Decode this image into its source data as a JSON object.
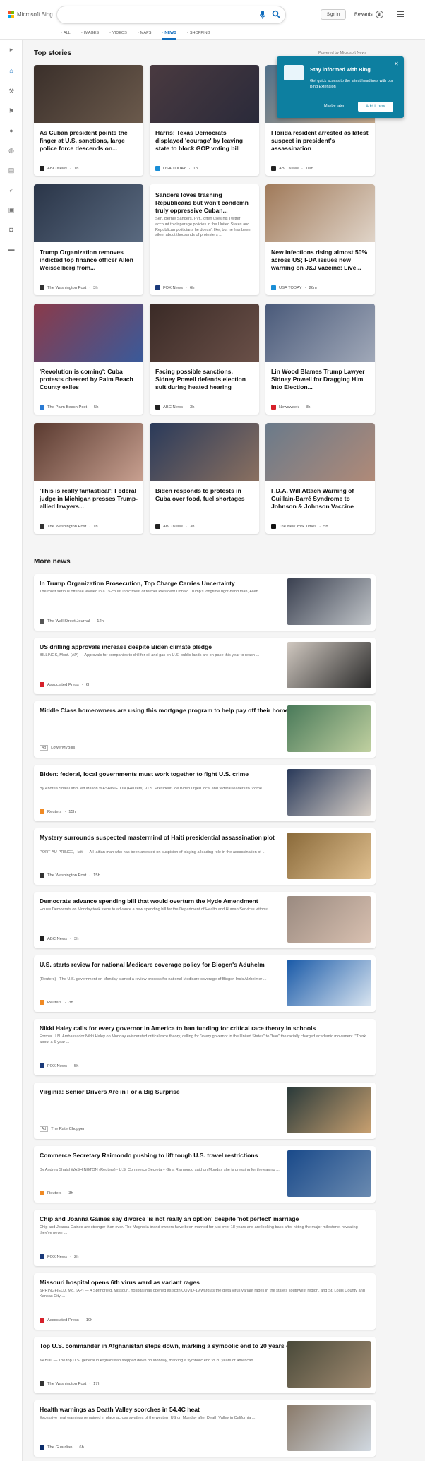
{
  "header": {
    "brand": "Microsoft Bing",
    "signin": "Sign in",
    "rewards": "Rewards"
  },
  "nav": [
    {
      "label": "ALL",
      "icon": "search-icon"
    },
    {
      "label": "IMAGES",
      "icon": "image-icon"
    },
    {
      "label": "VIDEOS",
      "icon": "video-icon"
    },
    {
      "label": "MAPS",
      "icon": "map-pin-icon"
    },
    {
      "label": "NEWS",
      "icon": "news-icon",
      "active": true
    },
    {
      "label": "SHOPPING",
      "icon": "tag-icon"
    }
  ],
  "top": {
    "title": "Top stories",
    "powered": "Powered by Microsoft News"
  },
  "popup": {
    "title": "Stay informed with Bing",
    "body": "Get quick access to the latest headlines with our Bing Extension",
    "later": "Maybe later",
    "add": "Add it now"
  },
  "cards": [
    {
      "title": "As Cuban president points the finger at U.S. sanctions, large police force descends on...",
      "snippet": "",
      "source": "ABC News",
      "time": "1h",
      "logo": "#222"
    },
    {
      "title": "Harris: Texas Democrats displayed 'courage' by leaving state to block GOP voting bill",
      "snippet": "",
      "source": "USA TODAY",
      "time": "1h",
      "logo": "#1a8ed6"
    },
    {
      "title": "Florida resident arrested as latest suspect in president's assassination",
      "snippet": "",
      "source": "ABC News",
      "time": "10m",
      "logo": "#222"
    },
    {
      "title": "Trump Organization removes indicted top finance officer Allen Weisselberg from...",
      "snippet": "",
      "source": "The Washington Post",
      "time": "3h",
      "logo": "#333"
    },
    {
      "title": "Sanders loves trashing Republicans but won't condemn truly oppressive Cuban...",
      "snippet": "Sen. Bernie Sanders, I-Vt., often uses his Twitter account to disparage policies in the United States and Republican politicians he doesn't like, but he has been silent about thousands of protesters ...",
      "source": "FOX News",
      "time": "6h",
      "logo": "#1b3a7a"
    },
    {
      "title": "New infections rising almost 50% across US; FDA issues new warning on J&J vaccine: Live...",
      "snippet": "",
      "source": "USA TODAY",
      "time": "26m",
      "logo": "#1a8ed6"
    },
    {
      "title": "'Revolution is coming': Cuba protests cheered by Palm Beach County exiles",
      "snippet": "",
      "source": "The Palm Beach Post",
      "time": "5h",
      "logo": "#2a7bd4"
    },
    {
      "title": "Facing possible sanctions, Sidney Powell defends election suit during heated hearing",
      "snippet": "",
      "source": "ABC News",
      "time": "3h",
      "logo": "#222"
    },
    {
      "title": "Lin Wood Blames Trump Lawyer Sidney Powell for Dragging Him Into Election...",
      "snippet": "",
      "source": "Newsweek",
      "time": "8h",
      "logo": "#d6202a"
    },
    {
      "title": "'This is really fantastical': Federal judge in Michigan presses Trump-allied lawyers...",
      "snippet": "",
      "source": "The Washington Post",
      "time": "1h",
      "logo": "#333"
    },
    {
      "title": "Biden responds to protests in Cuba over food, fuel shortages",
      "snippet": "",
      "source": "ABC News",
      "time": "3h",
      "logo": "#222"
    },
    {
      "title": "F.D.A. Will Attach Warning of Guillain-Barré Syndrome to Johnson & Johnson Vaccine",
      "snippet": "",
      "source": "The New York Times",
      "time": "5h",
      "logo": "#111"
    }
  ],
  "more": {
    "title": "More news"
  },
  "rows": [
    {
      "title": "In Trump Organization Prosecution, Top Charge Carries Uncertainty",
      "snippet": "The most serious offense leveled in a 15-count indictment of former President Donald Trump's longtime right-hand man, Allen ...",
      "source": "The Wall Street Journal",
      "time": "12h",
      "logo": "#555",
      "ad": false
    },
    {
      "title": "US drilling approvals increase despite Biden climate pledge",
      "snippet": "BILLINGS, Mont. (AP) — Approvals for companies to drill for oil and gas on U.S. public lands are on pace this year to reach ...",
      "source": "Associated Press",
      "time": "6h",
      "logo": "#d6202a",
      "ad": false
    },
    {
      "title": "Middle Class homeowners are using this mortgage program to help pay off their homes.",
      "snippet": "",
      "source": "LowerMyBills",
      "time": "",
      "logo": "#fff",
      "ad": true
    },
    {
      "title": "Biden: federal, local governments must work together to fight U.S. crime",
      "snippet": "By Andrea Shalal and Jeff Mason WASHINGTON (Reuters) -U.S. President Joe Biden urged local and federal leaders to \"come ...",
      "source": "Reuters",
      "time": "15h",
      "logo": "#f08a24",
      "ad": false
    },
    {
      "title": "Mystery surrounds suspected mastermind of Haiti presidential assassination plot",
      "snippet": "PORT-AU-PRINCE, Haiti — A Haitian man who has been arrested on suspicion of playing a leading role in the assassination of ...",
      "source": "The Washington Post",
      "time": "15h",
      "logo": "#333",
      "ad": false
    },
    {
      "title": "Democrats advance spending bill that would overturn the Hyde Amendment",
      "snippet": "House Democrats on Monday took steps to advance a new spending bill for the Department of Health and Human Services without ...",
      "source": "ABC News",
      "time": "3h",
      "logo": "#222",
      "ad": false
    },
    {
      "title": "U.S. starts review for national Medicare coverage policy for Biogen's Aduhelm",
      "snippet": "(Reuters) - The U.S. government on Monday started a review process for national Medicare coverage of Biogen Inc's Alzheimer ...",
      "source": "Reuters",
      "time": "3h",
      "logo": "#f08a24",
      "ad": false
    },
    {
      "title": "Nikki Haley calls for every governor in America to ban funding for critical race theory in schools",
      "snippet": "Former U.N. Ambassador Nikki Haley on Monday eviscerated critical race theory, calling for \"every governor in the United States\" to \"ban\" the racially charged academic movement. \"Think about a 5-year ...",
      "source": "FOX News",
      "time": "5h",
      "logo": "#1b3a7a",
      "ad": false
    },
    {
      "title": "Virginia: Senior Drivers Are in For a Big Surprise",
      "snippet": "",
      "source": "The Rate Chopper",
      "time": "",
      "logo": "#fff",
      "ad": true
    },
    {
      "title": "Commerce Secretary Raimondo pushing to lift tough U.S. travel restrictions",
      "snippet": "By Andrea Shalal WASHINGTON (Reuters) - U.S. Commerce Secretary Gina Raimondo said on Monday she is pressing for the easing ...",
      "source": "Reuters",
      "time": "3h",
      "logo": "#f08a24",
      "ad": false
    },
    {
      "title": "Chip and Joanna Gaines say divorce 'is not really an option' despite 'not perfect' marriage",
      "snippet": "Chip and Joanna Gaines are stronger than ever. The Magnolia brand owners have been married for just over 18 years and are looking back after hitting the major milestone, revealing they've never ...",
      "source": "FOX News",
      "time": "2h",
      "logo": "#1b3a7a",
      "ad": false
    },
    {
      "title": "Missouri hospital opens 6th virus ward as variant rages",
      "snippet": "SPRINGFIELD, Mo. (AP) — A Springfield, Missouri, hospital has opened its sixth COVID-19 ward as the delta virus variant rages in the state's southwest region, and St. Louis County and Kansas City ...",
      "source": "Associated Press",
      "time": "10h",
      "logo": "#d6202a",
      "ad": false
    },
    {
      "title": "Top U.S. commander in Afghanistan steps down, marking a symbolic end to 20 years of war",
      "snippet": "KABUL — The top U.S. general in Afghanistan stepped down on Monday, marking a symbolic end to 20 years of American ...",
      "source": "The Washington Post",
      "time": "17h",
      "logo": "#333",
      "ad": false
    },
    {
      "title": "Health warnings as Death Valley scorches in 54.4C heat",
      "snippet": "Excessive heat warnings remained in place across swathes of the western US on Monday after Death Valley in California ...",
      "source": "The Guardian",
      "time": "6h",
      "logo": "#0c2d6b",
      "ad": false
    }
  ]
}
